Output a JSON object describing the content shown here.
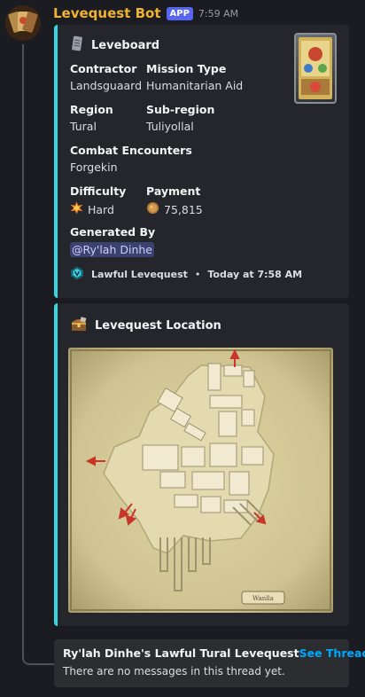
{
  "message": {
    "username": "Levequest Bot",
    "badge": "APP",
    "timestamp": "7:59 AM"
  },
  "leveboard": {
    "title": "Leveboard",
    "icon": "scroll-icon",
    "fields": {
      "contractor": {
        "name": "Contractor",
        "value": "Landsguaard"
      },
      "mission_type": {
        "name": "Mission Type",
        "value": "Humanitarian Aid"
      },
      "region": {
        "name": "Region",
        "value": "Tural"
      },
      "subregion": {
        "name": "Sub-region",
        "value": "Tuliyollal"
      },
      "combat": {
        "name": "Combat Encounters",
        "value": "Forgekin"
      },
      "difficulty": {
        "name": "Difficulty",
        "value": "Hard",
        "icon": "star-burst-icon"
      },
      "payment": {
        "name": "Payment",
        "value": "75,815",
        "icon": "gil-coin-icon"
      },
      "generated_by": {
        "name": "Generated By",
        "value": "@Ry'lah Dinhe"
      }
    },
    "footer": {
      "source": "Lawful Levequest",
      "separator": "•",
      "time": "Today at 7:58 AM"
    }
  },
  "location": {
    "title": "Levequest Location",
    "icon": "chest-icon",
    "map_label": "Wanlla"
  },
  "thread": {
    "name": "Ry'lah Dinhe's Lawful Tural Levequest",
    "link": "See Thread ›",
    "empty": "There are no messages in this thread yet."
  },
  "colors": {
    "accent": "#38d6e3",
    "username": "#f0b232",
    "link": "#00a8fc",
    "badge": "#5865f2"
  }
}
